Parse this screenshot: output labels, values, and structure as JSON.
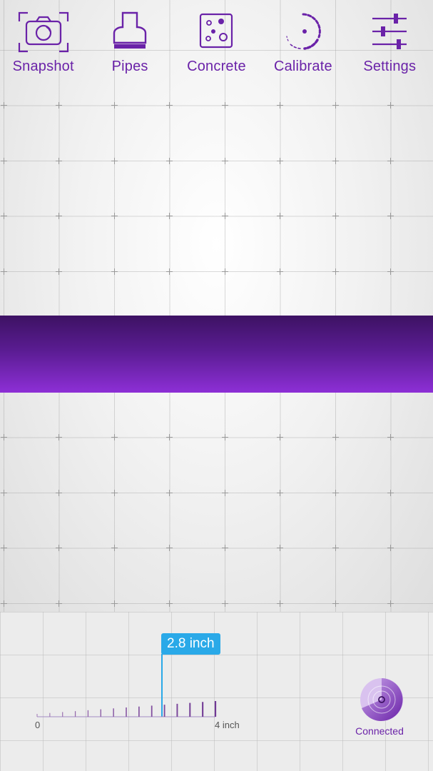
{
  "toolbar": {
    "items": [
      {
        "label": "Snapshot",
        "icon": "camera-icon"
      },
      {
        "label": "Pipes",
        "icon": "pipe-icon"
      },
      {
        "label": "Concrete",
        "icon": "concrete-icon"
      },
      {
        "label": "Calibrate",
        "icon": "calibrate-icon"
      },
      {
        "label": "Settings",
        "icon": "sliders-icon"
      }
    ]
  },
  "depth": {
    "value_label": "2.8 inch",
    "value": 2.8,
    "min_label": "0",
    "max_label": "4 inch",
    "max": 4
  },
  "status": {
    "label": "Connected",
    "icon": "connection-icon"
  },
  "colors": {
    "accent": "#6a22a8",
    "band_dark": "#3d1263",
    "band_light": "#8d2fd6",
    "readout": "#2aa9e8"
  }
}
